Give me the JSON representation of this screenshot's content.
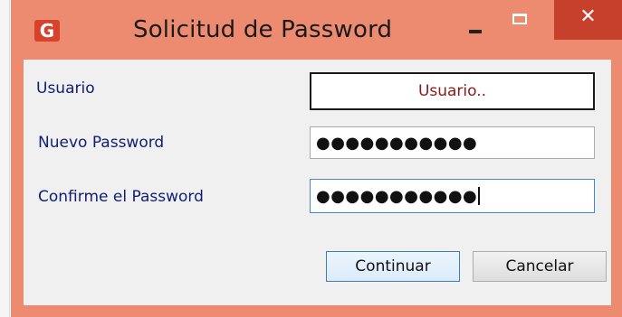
{
  "window": {
    "title": "Solicitud de Password",
    "icon_letter": "G",
    "controls": {
      "minimize_icon": "minimize-icon",
      "maximize_icon": "maximize-icon",
      "close_symbol": "✕"
    }
  },
  "form": {
    "user_label": "Usuario",
    "user_value": "Usuario..",
    "new_password_label": "Nuevo Password",
    "new_password_mask": "●●●●●●●●●●●",
    "confirm_password_label": "Confirme el Password",
    "confirm_password_mask": "●●●●●●●●●●●"
  },
  "buttons": {
    "continue_label": "Continuar",
    "cancel_label": "Cancelar"
  },
  "colors": {
    "title_bar": "#ed8b71",
    "close_button": "#c7402c",
    "label_text": "#0f1f73",
    "user_value_text": "#8a1a1a",
    "focus_border": "#3c89d8"
  }
}
